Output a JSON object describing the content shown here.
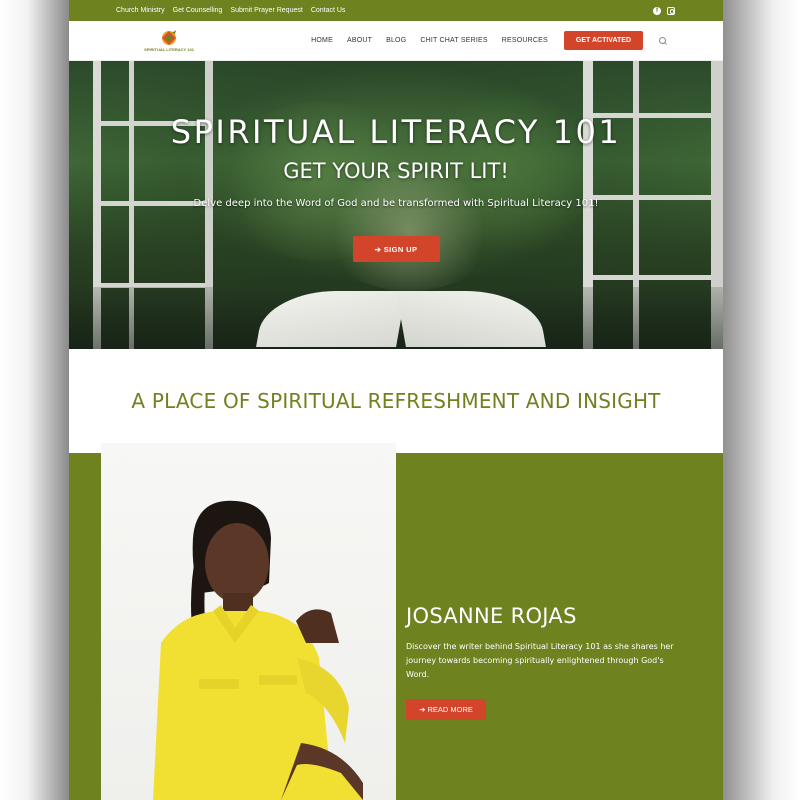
{
  "topbar": {
    "links": [
      "Church Ministry",
      "Get Counselling",
      "Submit Prayer Request",
      "Contact Us"
    ],
    "social": [
      "facebook-icon",
      "instagram-icon"
    ]
  },
  "header": {
    "logo_text": "SPIRITUAL LITERACY 101",
    "nav": [
      "HOME",
      "ABOUT",
      "BLOG",
      "CHIT CHAT SERIES",
      "RESOURCES"
    ],
    "cta_label": "GET ACTIVATED"
  },
  "hero": {
    "title": "SPIRITUAL LITERACY 101",
    "subtitle": "GET YOUR SPIRIT LIT!",
    "text": "Delve deep into the Word of God and be transformed with Spiritual Literacy 101!",
    "button_label": "➔ SIGN UP"
  },
  "section": {
    "heading": "A PLACE OF SPIRITUAL REFRESHMENT AND INSIGHT"
  },
  "author": {
    "name": "JOSANNE ROJAS",
    "description": "Discover the writer behind Spiritual Literacy 101 as she shares her journey towards becoming spiritually enlightened through God's Word.",
    "button_label": "➔ READ MORE"
  },
  "colors": {
    "brand_green": "#6f8220",
    "accent_red": "#d2452a"
  }
}
